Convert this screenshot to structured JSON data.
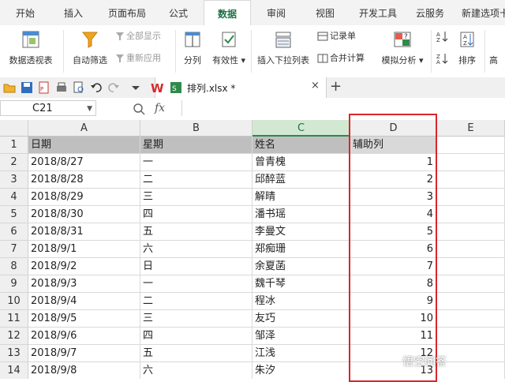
{
  "menu": {
    "tabs": [
      "开始",
      "插入",
      "页面布局",
      "公式",
      "数据",
      "审阅",
      "视图",
      "开发工具",
      "云服务",
      "新建选项卡"
    ],
    "active": "数据"
  },
  "ribbon": {
    "pivot": "数据透视表",
    "autofilter": "自动筛选",
    "show_all": "全部显示",
    "reapply": "重新应用",
    "split": "分列",
    "validity": "有效性",
    "dropdown": "插入下拉列表",
    "record": "记录单",
    "merge_calc": "合并计算",
    "simulate": "模拟分析",
    "sort": "排序",
    "high": "高"
  },
  "file_tab": {
    "name": "排列.xlsx *",
    "close": "×",
    "add": "+"
  },
  "formula_bar": {
    "name_box": "C21",
    "fx": "fx"
  },
  "columns": [
    "A",
    "B",
    "C",
    "D",
    "E"
  ],
  "rows": [
    {
      "n": "1",
      "a": "日期",
      "b": "星期",
      "c": "姓名",
      "d": "辅助列"
    },
    {
      "n": "2",
      "a": "2018/8/27",
      "b": "一",
      "c": "曾青槐",
      "d": "1"
    },
    {
      "n": "3",
      "a": "2018/8/28",
      "b": "二",
      "c": "邱醉蓝",
      "d": "2"
    },
    {
      "n": "4",
      "a": "2018/8/29",
      "b": "三",
      "c": "解晴",
      "d": "3"
    },
    {
      "n": "5",
      "a": "2018/8/30",
      "b": "四",
      "c": "潘书瑶",
      "d": "4"
    },
    {
      "n": "6",
      "a": "2018/8/31",
      "b": "五",
      "c": "李曼文",
      "d": "5"
    },
    {
      "n": "7",
      "a": "2018/9/1",
      "b": "六",
      "c": "郑痴珊",
      "d": "6"
    },
    {
      "n": "8",
      "a": "2018/9/2",
      "b": "日",
      "c": "余夏菡",
      "d": "7"
    },
    {
      "n": "9",
      "a": "2018/9/3",
      "b": "一",
      "c": "魏千琴",
      "d": "8"
    },
    {
      "n": "10",
      "a": "2018/9/4",
      "b": "二",
      "c": "程冰",
      "d": "9"
    },
    {
      "n": "11",
      "a": "2018/9/5",
      "b": "三",
      "c": "友巧",
      "d": "10"
    },
    {
      "n": "12",
      "a": "2018/9/6",
      "b": "四",
      "c": "邹泽",
      "d": "11"
    },
    {
      "n": "13",
      "a": "2018/9/7",
      "b": "五",
      "c": "江浅",
      "d": "12"
    },
    {
      "n": "14",
      "a": "2018/9/8",
      "b": "六",
      "c": "朱汐",
      "d": "13"
    }
  ],
  "watermark": "悟空问答",
  "colors": {
    "accent": "#1e7145",
    "highlight_border": "#d9262b"
  }
}
